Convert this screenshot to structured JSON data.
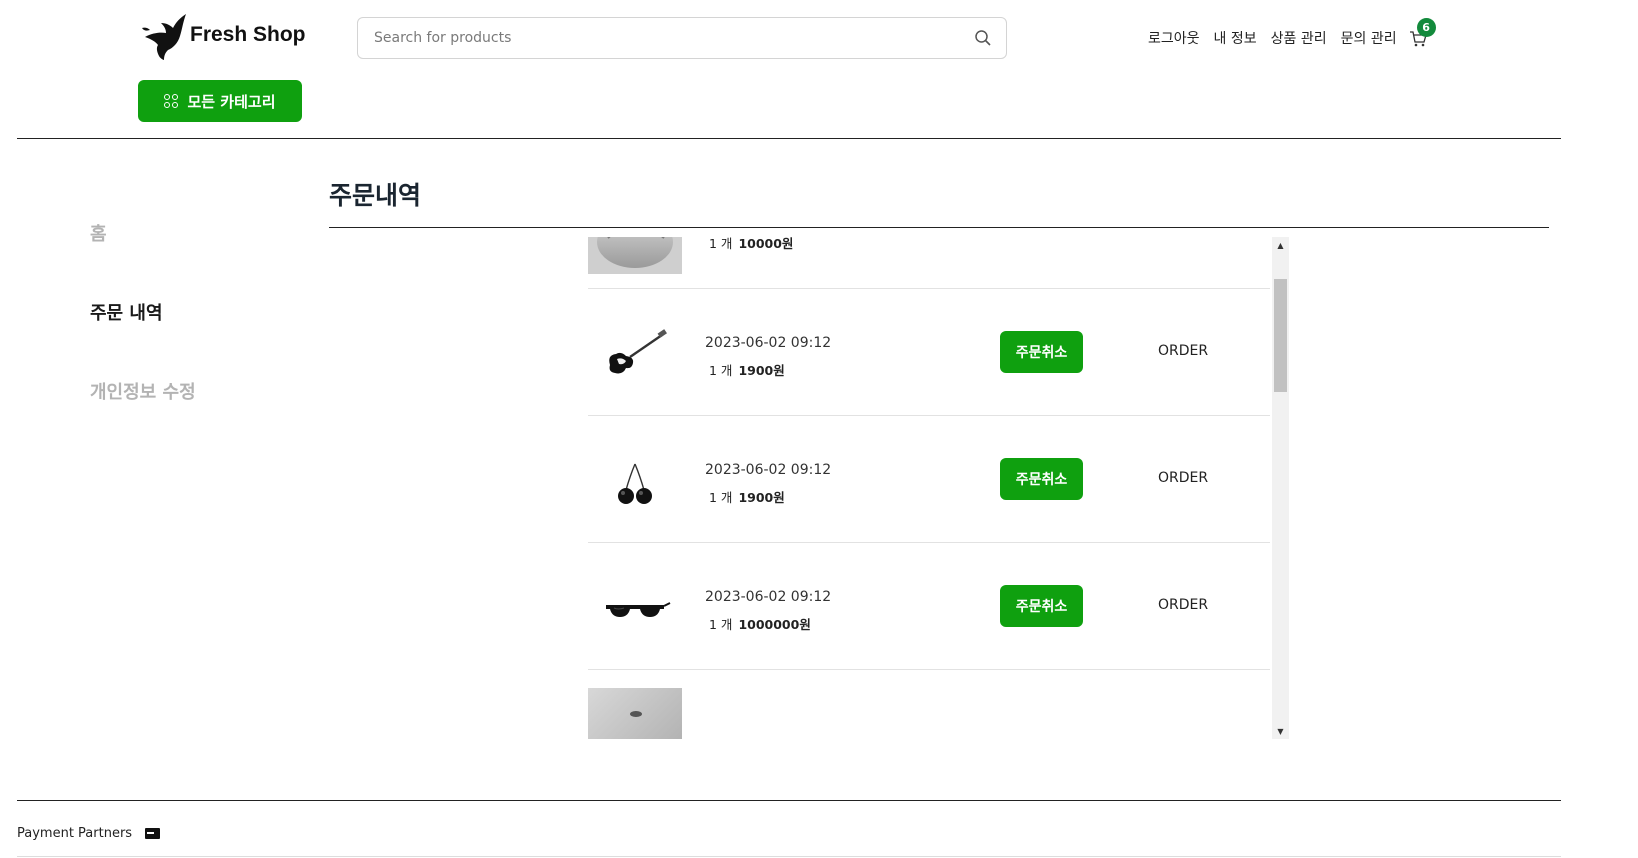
{
  "header": {
    "logo_text": "Fresh Shop",
    "all_categories_label": "모든 카테고리",
    "search_placeholder": "Search for products",
    "nav": [
      "로그아웃",
      "내 정보",
      "상품 관리",
      "문의 관리"
    ],
    "cart_count": "6"
  },
  "sidebar": {
    "items": [
      {
        "label": "홈",
        "active": false
      },
      {
        "label": "주문 내역",
        "active": true
      },
      {
        "label": "개인정보 수정",
        "active": false
      }
    ]
  },
  "page_title": "주문내역",
  "orders": [
    {
      "thumb": "gray-object-photo",
      "date": "",
      "qty": "1 개",
      "price": "10000원",
      "action": "",
      "status": ""
    },
    {
      "thumb": "guitar-image",
      "date": "2023-06-02 09:12",
      "qty": "1 개",
      "price": "1900원",
      "action": "주문취소",
      "status": "ORDER"
    },
    {
      "thumb": "cherries-image",
      "date": "2023-06-02 09:12",
      "qty": "1 개",
      "price": "1900원",
      "action": "주문취소",
      "status": "ORDER"
    },
    {
      "thumb": "sunglasses-image",
      "date": "2023-06-02 09:12",
      "qty": "1 개",
      "price": "1000000원",
      "action": "주문취소",
      "status": "ORDER"
    },
    {
      "thumb": "gray-object-photo",
      "date": "",
      "qty": "",
      "price": "",
      "action": "",
      "status": ""
    }
  ],
  "footer": {
    "payment_partners": "Payment Partners"
  },
  "colors": {
    "accent_green": "#0fa00f",
    "badge_green": "#138a3c",
    "inactive_sidebar": "#b3b3b3"
  }
}
